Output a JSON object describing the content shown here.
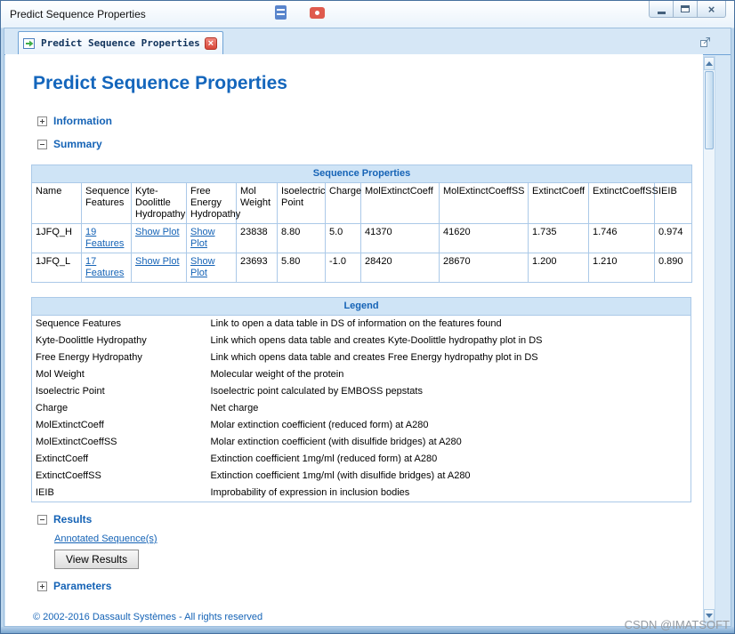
{
  "window": {
    "title": "Predict Sequence Properties"
  },
  "tab": {
    "label": "Predict Sequence Properties"
  },
  "icons": {
    "close": "×"
  },
  "page": {
    "title": "Predict Sequence Properties",
    "sections": {
      "information": "Information",
      "summary": "Summary",
      "results": "Results",
      "parameters": "Parameters"
    },
    "footer": "© 2002-2016 Dassault Systèmes - All rights reserved"
  },
  "properties_table": {
    "title": "Sequence Properties",
    "columns": [
      "Name",
      "Sequence Features",
      "Kyte-Doolittle Hydropathy",
      "Free Energy Hydropathy",
      "Mol Weight",
      "Isoelectric Point",
      "Charge",
      "MolExtinctCoeff",
      "MolExtinctCoeffSS",
      "ExtinctCoeff",
      "ExtinctCoeffSS",
      "IEIB"
    ],
    "rows": [
      [
        "1JFQ_H",
        "19 Features",
        "Show Plot",
        "Show Plot",
        "23838",
        "8.80",
        "5.0",
        "41370",
        "41620",
        "1.735",
        "1.746",
        "0.974"
      ],
      [
        "1JFQ_L",
        "17 Features",
        "Show Plot",
        "Show Plot",
        "23693",
        "5.80",
        "-1.0",
        "28420",
        "28670",
        "1.200",
        "1.210",
        "0.890"
      ]
    ]
  },
  "legend_table": {
    "title": "Legend",
    "rows": [
      [
        "Sequence Features",
        "Link to open a data table in DS of information on the features found"
      ],
      [
        "Kyte-Doolittle Hydropathy",
        "Link which opens data table and creates Kyte-Doolittle hydropathy plot in DS"
      ],
      [
        "Free Energy Hydropathy",
        "Link which opens data table and creates Free Energy hydropathy plot in DS"
      ],
      [
        "Mol Weight",
        "Molecular weight of the protein"
      ],
      [
        "Isoelectric Point",
        "Isoelectric point calculated by EMBOSS pepstats"
      ],
      [
        "Charge",
        "Net charge"
      ],
      [
        "MolExtinctCoeff",
        "Molar extinction coefficient (reduced form) at A280"
      ],
      [
        "MolExtinctCoeffSS",
        "Molar extinction coefficient (with disulfide bridges) at A280"
      ],
      [
        "ExtinctCoeff",
        "Extinction coefficient 1mg/ml (reduced form) at A280"
      ],
      [
        "ExtinctCoeffSS",
        "Extinction coefficient 1mg/ml (with disulfide bridges) at A280"
      ],
      [
        "IEIB",
        "Improbability of expression in inclusion bodies"
      ]
    ]
  },
  "results": {
    "link_label": "Annotated Sequence(s)",
    "button_label": "View Results"
  },
  "watermark": "CSDN @IMATSOFT"
}
